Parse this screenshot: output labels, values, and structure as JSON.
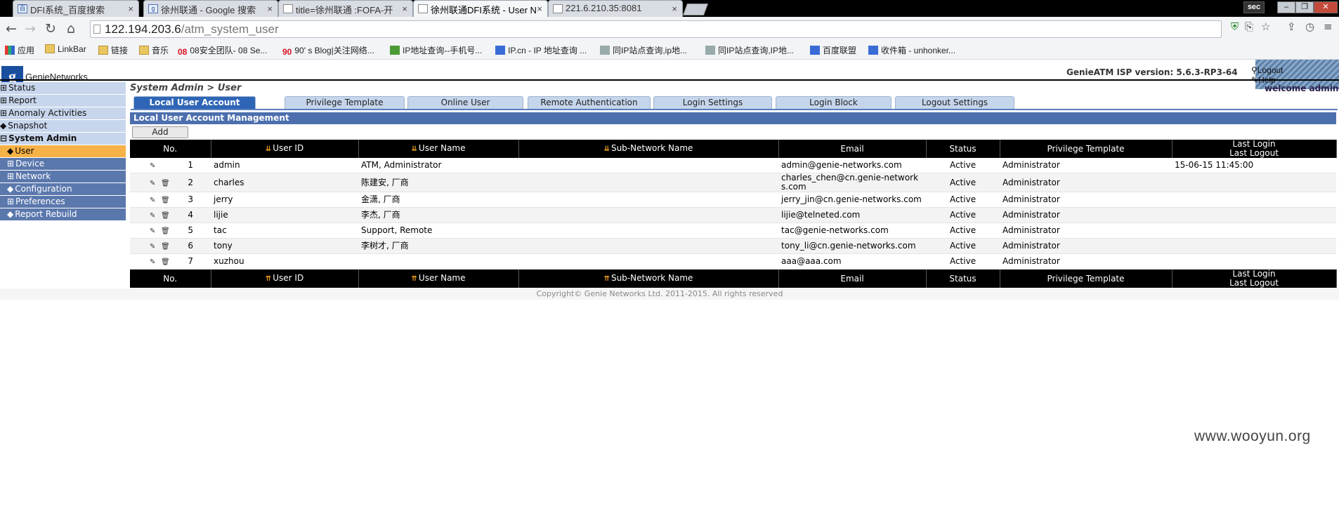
{
  "browser": {
    "tabs": [
      {
        "title": "DFI系统_百度搜索",
        "active": false
      },
      {
        "title": "徐州联通 - Google 搜索",
        "active": false
      },
      {
        "title": "title=徐州联通 :FOFA-开",
        "active": false
      },
      {
        "title": "徐州联通DFI系统 - User N",
        "active": true
      },
      {
        "title": "221.6.210.35:8081",
        "active": false
      }
    ],
    "profile_label": "sec",
    "url_host": "122.194.203.6",
    "url_path": "/atm_system_user",
    "bookmarks": [
      {
        "label": "应用",
        "icon": "apps-grid-icon"
      },
      {
        "label": "LinkBar",
        "icon": "folder-icon"
      },
      {
        "label": "链接",
        "icon": "folder-icon"
      },
      {
        "label": "音乐",
        "icon": "folder-icon"
      },
      {
        "label": "08安全团队- 08 Se...",
        "icon": "08-logo-icon"
      },
      {
        "label": "90' s Blog|关注网络...",
        "icon": "90-logo-icon"
      },
      {
        "label": "IP地址查询--手机号...",
        "icon": "ip-icon"
      },
      {
        "label": "IP.cn - IP 地址查询 ...",
        "icon": "ipcn-icon"
      },
      {
        "label": "同IP站点查询,ip地...",
        "icon": "site-icon"
      },
      {
        "label": "同IP站点查询,IP地...",
        "icon": "site2-icon"
      },
      {
        "label": "百度联盟",
        "icon": "baidu-icon"
      },
      {
        "label": "收件箱 - unhonker...",
        "icon": "mail-icon"
      }
    ]
  },
  "header": {
    "logo_letter": "g",
    "logo_text": "GenieNetworks",
    "logout_label": "Logout",
    "help_label": "Help",
    "version": "GenieATM ISP version: 5.6.3-RP3-64",
    "welcome": "welcome admin"
  },
  "sidebar": {
    "items": [
      {
        "label": "Status",
        "level": "top",
        "marker": "⊞"
      },
      {
        "label": "Report",
        "level": "top",
        "marker": "⊞"
      },
      {
        "label": "Anomaly Activities",
        "level": "top",
        "marker": "⊞"
      },
      {
        "label": "Snapshot",
        "level": "top",
        "marker": "◆"
      },
      {
        "label": "System Admin",
        "level": "top-open",
        "marker": "⊟"
      },
      {
        "label": "User",
        "level": "sub-selected",
        "marker": "◆"
      },
      {
        "label": "Device",
        "level": "sub",
        "marker": "⊞"
      },
      {
        "label": "Network",
        "level": "sub",
        "marker": "⊞"
      },
      {
        "label": "Configuration",
        "level": "sub",
        "marker": "◆"
      },
      {
        "label": "Preferences",
        "level": "sub",
        "marker": "⊞"
      },
      {
        "label": "Report Rebuild",
        "level": "sub",
        "marker": "◆"
      }
    ]
  },
  "main": {
    "breadcrumb": "System Admin > User",
    "tabs": [
      "Local User Account",
      "Privilege Template",
      "Online User",
      "Remote Authentication",
      "Login Settings",
      "Login Block",
      "Logout Settings"
    ],
    "section_title": "Local User Account Management",
    "add_label": "Add",
    "columns": [
      "No.",
      "User ID",
      "User Name",
      "Sub-Network Name",
      "Email",
      "Status",
      "Privilege Template",
      "Last Login",
      "Last Logout"
    ],
    "rows": [
      {
        "no": "1",
        "user_id": "admin",
        "user_name": "ATM, Administrator",
        "subnet": "",
        "email": "admin@genie-networks.com",
        "status": "Active",
        "privilege": "Administrator",
        "last": "15-06-15 11:45:00",
        "deletable": false
      },
      {
        "no": "2",
        "user_id": "charles",
        "user_name": "陈建安, 厂商",
        "subnet": "",
        "email": "charles_chen@cn.genie-networks.com",
        "status": "Active",
        "privilege": "Administrator",
        "last": "",
        "deletable": true
      },
      {
        "no": "3",
        "user_id": "jerry",
        "user_name": "金潇, 厂商",
        "subnet": "",
        "email": "jerry_jin@cn.genie-networks.com",
        "status": "Active",
        "privilege": "Administrator",
        "last": "",
        "deletable": true
      },
      {
        "no": "4",
        "user_id": "lijie",
        "user_name": "李杰, 厂商",
        "subnet": "",
        "email": "lijie@telneted.com",
        "status": "Active",
        "privilege": "Administrator",
        "last": "",
        "deletable": true
      },
      {
        "no": "5",
        "user_id": "tac",
        "user_name": "Support, Remote",
        "subnet": "",
        "email": "tac@genie-networks.com",
        "status": "Active",
        "privilege": "Administrator",
        "last": "",
        "deletable": true
      },
      {
        "no": "6",
        "user_id": "tony",
        "user_name": "李树才, 厂商",
        "subnet": "",
        "email": "tony_li@cn.genie-networks.com",
        "status": "Active",
        "privilege": "Administrator",
        "last": "",
        "deletable": true
      },
      {
        "no": "7",
        "user_id": "xuzhou",
        "user_name": "",
        "subnet": "",
        "email": "aaa@aaa.com",
        "status": "Active",
        "privilege": "Administrator",
        "last": "",
        "deletable": true
      }
    ],
    "copyright": "Copyright© Genie Networks Ltd. 2011-2015. All rights reserved"
  },
  "watermark": "www.wooyun.org"
}
